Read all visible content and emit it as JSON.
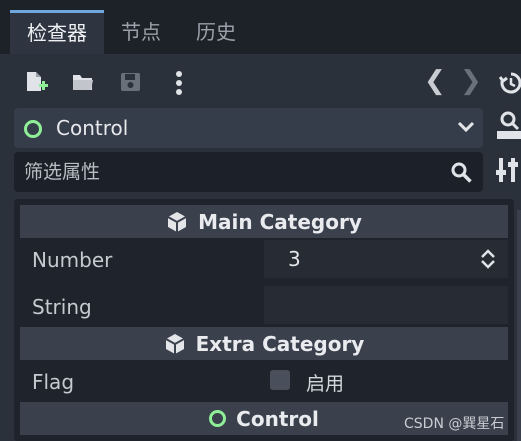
{
  "tabs": [
    {
      "label": "检查器",
      "active": true
    },
    {
      "label": "节点",
      "active": false
    },
    {
      "label": "历史",
      "active": false
    }
  ],
  "toolbar": {
    "icons": [
      "new-resource-icon",
      "open-folder-icon",
      "save-icon",
      "more-icon"
    ],
    "nav_back": "❮",
    "nav_forward": "❯",
    "history_icon": "history-icon"
  },
  "object_selector": {
    "value": "Control",
    "icon": "green-circle-icon"
  },
  "filter": {
    "placeholder": "筛选属性",
    "value": ""
  },
  "categories": [
    {
      "title": "Main Category",
      "icon": "cube-icon"
    },
    {
      "title": "Extra Category",
      "icon": "cube-icon"
    },
    {
      "title": "Control",
      "icon": "green-circle-icon"
    }
  ],
  "properties": {
    "number": {
      "label": "Number",
      "value": "3"
    },
    "string": {
      "label": "String",
      "value": ""
    },
    "flag": {
      "label": "Flag",
      "checkbox_label": "启用",
      "checked": false
    }
  },
  "watermark": "CSDN @巽星石",
  "colors": {
    "accent": "#6fa8dc",
    "green": "#8eef97",
    "panel": "#2b313b",
    "category": "#3a414d"
  }
}
